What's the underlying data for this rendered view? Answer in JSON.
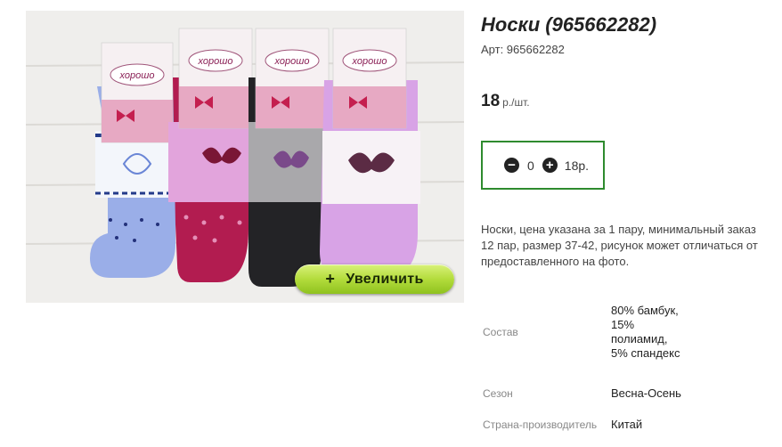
{
  "product": {
    "title": "Носки (965662282)",
    "article": "Арт: 965662282",
    "price_value": "18",
    "price_unit": "р./шт.",
    "description": "Носки, цена указана за 1 пару, минимальный заказ 12 пар, размер 37-42, рисунок может отличаться от предоставленного на фото."
  },
  "quantity": {
    "minus_icon": "minus-circle-icon",
    "plus_icon": "plus-circle-icon",
    "value": "0",
    "sum": "18р."
  },
  "image": {
    "zoom_label": "Увеличить",
    "zoom_icon": "plus-icon",
    "brand": "хорошо",
    "sock_colors": [
      "#9aaee8",
      "#b21c50",
      "#2a2a2e",
      "#d8a3e6"
    ],
    "accent_color": "#8fc21f"
  },
  "properties": [
    {
      "key": "Состав",
      "value": "80% бамбук, 15% полиамид, 5% спандекс"
    },
    {
      "key": "Сезон",
      "value": "Весна-Осень"
    },
    {
      "key": "Страна-производитель",
      "value": "Китай"
    }
  ]
}
